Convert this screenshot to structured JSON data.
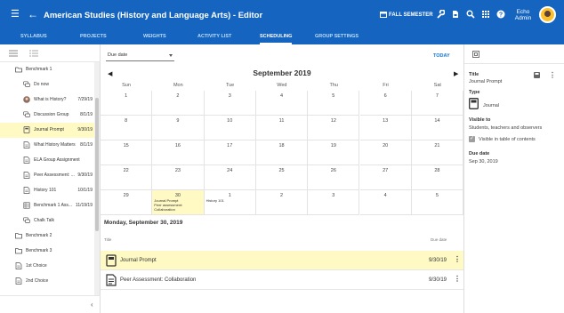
{
  "header": {
    "title": "American Studies (History and Language Arts) - Editor",
    "semester": "FALL SEMESTER",
    "user_first": "Echo",
    "user_second": "Admin",
    "color": "#1565c0"
  },
  "tabs": [
    "SYLLABUS",
    "PROJECTS",
    "WEIGHTS",
    "ACTIVITY LIST",
    "SCHEDULING",
    "GROUP SETTINGS"
  ],
  "active_tab": "SCHEDULING",
  "sidebar": {
    "items": [
      {
        "label": "Benchmark 1",
        "date": "",
        "icon": "folder-open-icon",
        "indent": 0
      },
      {
        "label": "Do now",
        "date": "",
        "icon": "chat-icon",
        "indent": 1
      },
      {
        "label": "What is History?",
        "date": "7/29/19",
        "icon": "avatar-icon",
        "indent": 1
      },
      {
        "label": "Discussion Group",
        "date": "8/1/19",
        "icon": "chat-icon",
        "indent": 1
      },
      {
        "label": "Journal Prompt",
        "date": "9/30/19",
        "icon": "journal-icon",
        "indent": 1,
        "selected": true
      },
      {
        "label": "What History Matters",
        "date": "8/1/19",
        "icon": "document-icon",
        "indent": 1
      },
      {
        "label": "ELA Group Assignment",
        "date": "",
        "icon": "document-icon",
        "indent": 1
      },
      {
        "label": "Peer Assessment: ...",
        "date": "9/30/19",
        "icon": "document-icon",
        "indent": 1
      },
      {
        "label": "History 101",
        "date": "10/1/19",
        "icon": "document-icon",
        "indent": 1
      },
      {
        "label": "Benchmark 1 Ass...",
        "date": "11/19/19",
        "icon": "grid-icon",
        "indent": 1
      },
      {
        "label": "Chalk Talk",
        "date": "",
        "icon": "chat-icon",
        "indent": 1
      },
      {
        "label": "Benchmark 2",
        "date": "",
        "icon": "folder-icon",
        "indent": 0
      },
      {
        "label": "Benchmark 3",
        "date": "",
        "icon": "folder-icon",
        "indent": 0
      },
      {
        "label": "1st Choice",
        "date": "",
        "icon": "document-icon",
        "indent": 0
      },
      {
        "label": "2nd Choice",
        "date": "",
        "icon": "document-icon",
        "indent": 0
      }
    ]
  },
  "calendar": {
    "filter": "Due date",
    "today_label": "TODAY",
    "month": "September 2019",
    "days_of_week": [
      "Sun",
      "Mon",
      "Tue",
      "Wed",
      "Thu",
      "Fri",
      "Sat"
    ],
    "weeks": [
      [
        "1",
        "2",
        "3",
        "4",
        "5",
        "6",
        "7"
      ],
      [
        "8",
        "9",
        "10",
        "11",
        "12",
        "13",
        "14"
      ],
      [
        "15",
        "16",
        "17",
        "18",
        "19",
        "20",
        "21"
      ],
      [
        "22",
        "23",
        "24",
        "25",
        "26",
        "27",
        "28"
      ],
      [
        "29",
        "30",
        "1",
        "2",
        "3",
        "4",
        "5"
      ]
    ],
    "events": {
      "mon30": [
        "Journal Prompt",
        "Peer assessment:",
        "Collaboration"
      ],
      "tue1": [
        "History 101"
      ]
    }
  },
  "agenda": {
    "title": "Monday, September 30, 2019",
    "col_title": "Title",
    "col_date": "Due date",
    "rows": [
      {
        "label": "Journal Prompt",
        "date": "9/30/19",
        "selected": true
      },
      {
        "label": "Peer Assessment: Collaboration",
        "date": "9/30/19",
        "selected": false
      }
    ]
  },
  "details": {
    "title_label": "Title",
    "title_value": "Journal Prompt",
    "type_label": "Type",
    "type_value": "Journal",
    "visible_label": "Visible to",
    "visible_value": "Students, teachers and observers",
    "toc_label": "Visible in table of contents",
    "due_label": "Due date",
    "due_value": "Sep 30, 2019"
  }
}
